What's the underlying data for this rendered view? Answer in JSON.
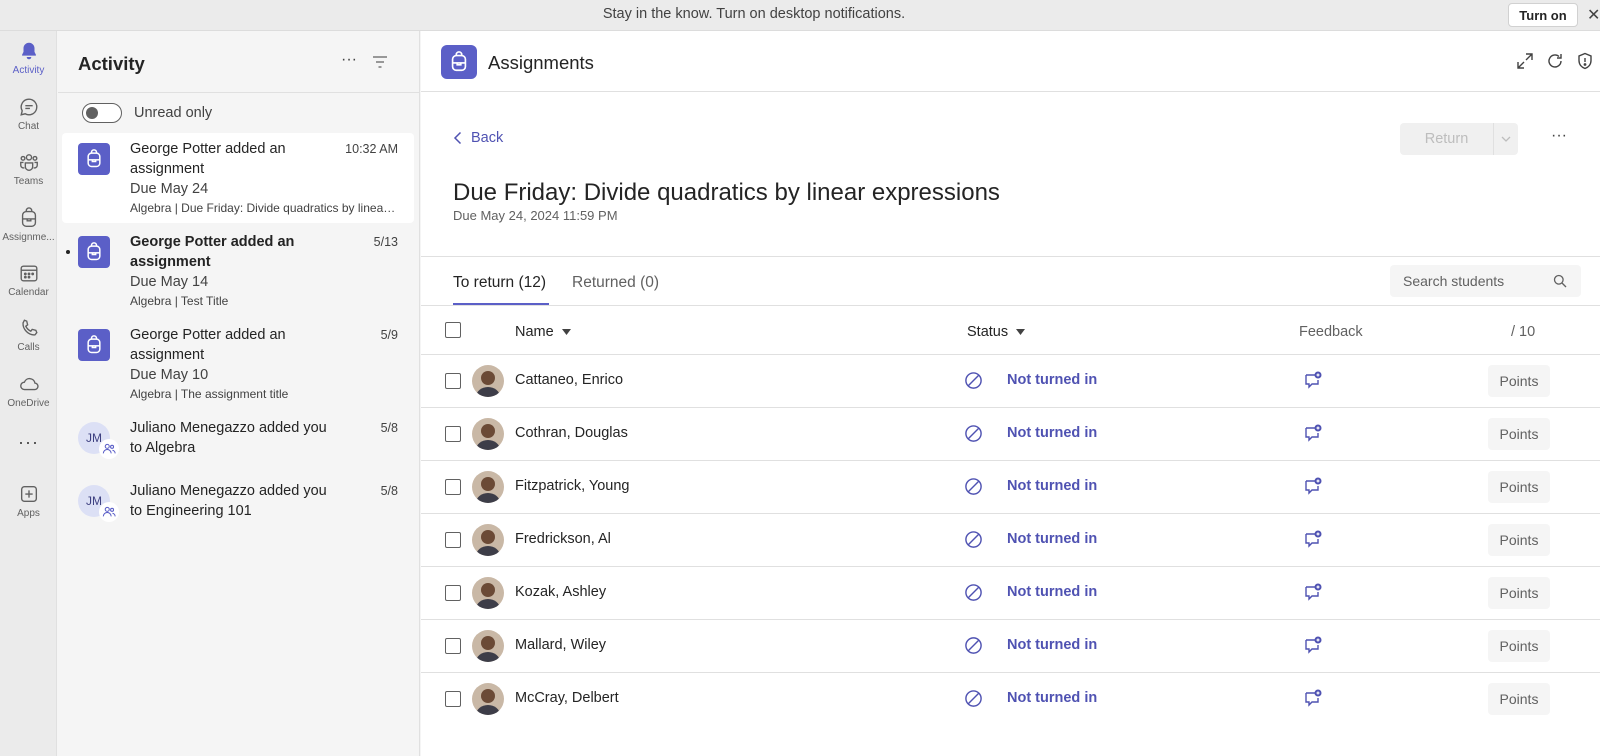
{
  "banner": {
    "text": "Stay in the know. Turn on desktop notifications.",
    "button_label": "Turn on"
  },
  "rail": {
    "items": [
      {
        "label": "Activity",
        "icon": "bell-icon",
        "active": true
      },
      {
        "label": "Chat",
        "icon": "chat-icon"
      },
      {
        "label": "Teams",
        "icon": "teams-icon"
      },
      {
        "label": "Assignme...",
        "icon": "backpack-icon"
      },
      {
        "label": "Calendar",
        "icon": "calendar-icon"
      },
      {
        "label": "Calls",
        "icon": "phone-icon"
      },
      {
        "label": "OneDrive",
        "icon": "cloud-icon"
      },
      {
        "label": "Apps",
        "icon": "add-app-icon"
      }
    ],
    "more_label": "···"
  },
  "activity": {
    "title": "Activity",
    "more_label": "···",
    "unread_toggle_label": "Unread only",
    "items": [
      {
        "title": "George Potter added an assignment",
        "time": "10:32 AM",
        "due": "Due May 24",
        "subtitle": "Algebra | Due Friday: Divide quadratics by linear expressions",
        "icon": "backpack-icon",
        "selected": true
      },
      {
        "title": "George Potter added an assignment",
        "time": "5/13",
        "due": "Due May 14",
        "subtitle": "Algebra | Test Title",
        "icon": "backpack-icon",
        "unread": true
      },
      {
        "title": "George Potter added an assignment",
        "time": "5/9",
        "due": "Due May 10",
        "subtitle": "Algebra | The assignment title",
        "icon": "backpack-icon"
      },
      {
        "title": "Juliano Menegazzo added you to Algebra",
        "time": "5/8",
        "initials": "JM",
        "icon": "people-add-icon"
      },
      {
        "title": "Juliano Menegazzo added you to Engineering 101",
        "time": "5/8",
        "initials": "JM",
        "icon": "people-add-icon"
      }
    ]
  },
  "app": {
    "title": "Assignments"
  },
  "assignment": {
    "back_label": "Back",
    "return_label": "Return",
    "more_label": "···",
    "title": "Due Friday: Divide quadratics by linear expressions",
    "due": "Due May 24, 2024 11:59 PM",
    "tabs": [
      "To return (12)",
      "Returned (0)"
    ],
    "search_placeholder": "Search students",
    "columns": {
      "name": "Name",
      "status": "Status",
      "feedback": "Feedback",
      "points": "/ 10"
    },
    "students": [
      {
        "name": "Cattaneo, Enrico",
        "status": "Not turned in",
        "points_label": "Points"
      },
      {
        "name": "Cothran, Douglas",
        "status": "Not turned in",
        "points_label": "Points"
      },
      {
        "name": "Fitzpatrick, Young",
        "status": "Not turned in",
        "points_label": "Points"
      },
      {
        "name": "Fredrickson, Al",
        "status": "Not turned in",
        "points_label": "Points"
      },
      {
        "name": "Kozak, Ashley",
        "status": "Not turned in",
        "points_label": "Points"
      },
      {
        "name": "Mallard, Wiley",
        "status": "Not turned in",
        "points_label": "Points"
      },
      {
        "name": "McCray, Delbert",
        "status": "Not turned in",
        "points_label": "Points"
      }
    ]
  },
  "colors": {
    "accent": "#5b5fc7",
    "link": "#4f52b2"
  }
}
